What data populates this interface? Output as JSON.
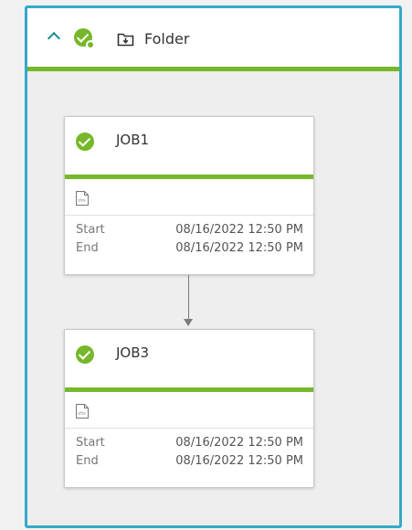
{
  "folder": {
    "title": "Folder",
    "status": "ended-ok",
    "border_color": "#36a9c9",
    "status_color": "#76b82a"
  },
  "jobs": [
    {
      "name": "JOB1",
      "type_icon": "os-file-icon",
      "start_label": "Start",
      "start_value": "08/16/2022 12:50 PM",
      "end_label": "End",
      "end_value": "08/16/2022 12:50 PM",
      "status": "ended-ok"
    },
    {
      "name": "JOB3",
      "type_icon": "os-file-icon",
      "start_label": "Start",
      "start_value": "08/16/2022 12:50 PM",
      "end_label": "End",
      "end_value": "08/16/2022 12:50 PM",
      "status": "ended-ok"
    }
  ],
  "icons": {
    "collapse": "chevron-up-icon",
    "folder_status": "check-circle-icon",
    "folder": "folder-icon",
    "job_status": "check-circle-icon",
    "job_type": "os-file-icon",
    "flow": "arrow-down-icon"
  }
}
